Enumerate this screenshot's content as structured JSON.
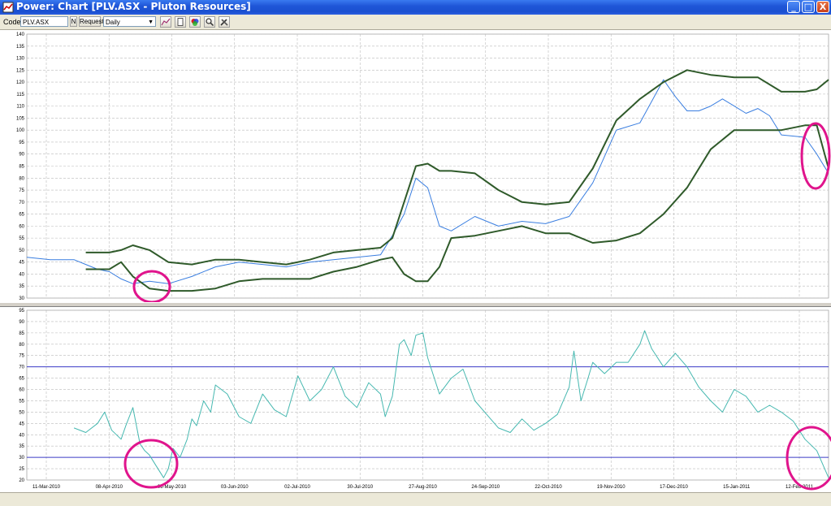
{
  "window": {
    "title": "Power: Chart [PLV.ASX - Pluton Resources]",
    "buttons": [
      "_",
      "□",
      "X"
    ]
  },
  "toolbar": {
    "code_label": "Code:",
    "code_value": "PLV.ASX",
    "n_button": "N",
    "request_button": "Request",
    "period_value": "Daily",
    "icons": [
      "indicator-icon",
      "new-chart-icon",
      "colors-icon",
      "zoom-icon",
      "tools-icon"
    ]
  },
  "colors": {
    "price": "#3a7ee0",
    "bands": "#2f5a2a",
    "band_faded": "#9fb59c",
    "rsi": "#46b8b0",
    "rsi_faded": "#b8e4e0",
    "level_lines": "#3c3cc8",
    "annotation_circle": "#e0148c",
    "grid": "#bbbbbb"
  },
  "x_axis_labels": [
    "11-Mar-2010",
    "08-Apr-2010",
    "06-May-2010",
    "03-Jun-2010",
    "02-Jul-2010",
    "30-Jul-2010",
    "27-Aug-2010",
    "24-Sep-2010",
    "22-Oct-2010",
    "19-Nov-2010",
    "17-Dec-2010",
    "15-Jan-2011",
    "12-Feb-2011"
  ],
  "chart_data": [
    {
      "type": "line",
      "y_ticks": [
        30,
        35,
        40,
        45,
        50,
        55,
        60,
        65,
        70,
        75,
        80,
        85,
        90,
        95,
        100,
        105,
        110,
        115,
        120,
        125,
        130,
        135,
        140
      ],
      "ylim": [
        30,
        140
      ],
      "grid": true,
      "series": [
        {
          "x": [
            0,
            10,
            20,
            25,
            30,
            35,
            40,
            45,
            52,
            60,
            70,
            80,
            90,
            100,
            110,
            120,
            130,
            140,
            150,
            155,
            160,
            165,
            170,
            175,
            180,
            190,
            200,
            210,
            220,
            230,
            240,
            250,
            260,
            265,
            270,
            275,
            280,
            285,
            290,
            295,
            300,
            305,
            310,
            315,
            320,
            330,
            335,
            340
          ],
          "values": [
            47,
            46,
            46,
            44,
            42,
            41,
            38,
            36,
            37,
            36,
            39,
            43,
            45,
            44,
            43,
            45,
            46,
            47,
            48,
            56,
            65,
            80,
            76,
            60,
            58,
            64,
            60,
            62,
            61,
            64,
            78,
            100,
            103,
            112,
            121,
            114,
            108,
            108,
            110,
            113,
            110,
            107,
            109,
            106,
            98,
            97,
            90,
            82
          ]
        },
        {
          "x": [
            25,
            35,
            40,
            45,
            52,
            60,
            70,
            80,
            90,
            100,
            110,
            120,
            130,
            140,
            150,
            155,
            160,
            165,
            170,
            175,
            180,
            190,
            200,
            210,
            220,
            230,
            240,
            250,
            260,
            270,
            280,
            290,
            300,
            310,
            320,
            330,
            335,
            340
          ],
          "values": [
            49,
            49,
            50,
            52,
            50,
            45,
            44,
            46,
            46,
            45,
            44,
            46,
            49,
            50,
            51,
            55,
            70,
            85,
            86,
            83,
            83,
            82,
            75,
            70,
            69,
            70,
            84,
            104,
            113,
            120,
            125,
            123,
            122,
            122,
            116,
            116,
            117,
            121
          ]
        },
        {
          "x": [
            25,
            35,
            40,
            45,
            52,
            60,
            70,
            80,
            90,
            100,
            110,
            120,
            130,
            140,
            150,
            155,
            160,
            165,
            170,
            175,
            180,
            190,
            200,
            210,
            220,
            230,
            240,
            250,
            260,
            265,
            270,
            280,
            290,
            300,
            310,
            320,
            330,
            335,
            340
          ],
          "values": [
            42,
            42,
            45,
            39,
            34,
            33,
            33,
            34,
            37,
            38,
            38,
            38,
            41,
            43,
            46,
            47,
            40,
            37,
            37,
            43,
            55,
            56,
            58,
            60,
            57,
            57,
            53,
            54,
            57,
            61,
            65,
            76,
            92,
            100,
            100,
            100,
            102,
            102,
            84
          ]
        }
      ]
    },
    {
      "type": "line",
      "y_ticks": [
        20,
        25,
        30,
        35,
        40,
        45,
        50,
        55,
        60,
        65,
        70,
        75,
        80,
        85,
        90,
        95
      ],
      "ylim": [
        20,
        95
      ],
      "grid": true,
      "series": [
        {
          "x": [
            20,
            25,
            30,
            33,
            36,
            40,
            42,
            45,
            48,
            50,
            52,
            55,
            58,
            60,
            62,
            65,
            68,
            70,
            72,
            75,
            78,
            80,
            85,
            90,
            95,
            100,
            105,
            110,
            115,
            120,
            125,
            130,
            135,
            140,
            145,
            150,
            152,
            155,
            158,
            160,
            163,
            165,
            168,
            170,
            175,
            180,
            185,
            190,
            195,
            200,
            205,
            210,
            215,
            220,
            225,
            230,
            232,
            235,
            238,
            240,
            245,
            250,
            255,
            260,
            262,
            265,
            270,
            275,
            280,
            285,
            290,
            295,
            300,
            305,
            310,
            315,
            320,
            325,
            330,
            335,
            340
          ],
          "values": [
            43,
            41,
            45,
            50,
            42,
            38,
            44,
            52,
            36,
            33,
            31,
            26,
            21,
            25,
            34,
            30,
            38,
            47,
            44,
            55,
            50,
            62,
            58,
            48,
            45,
            58,
            51,
            48,
            66,
            55,
            60,
            70,
            57,
            52,
            63,
            58,
            48,
            57,
            80,
            82,
            75,
            84,
            85,
            74,
            58,
            65,
            69,
            55,
            49,
            43,
            41,
            47,
            42,
            45,
            49,
            61,
            77,
            55,
            65,
            72,
            67,
            72,
            72,
            80,
            86,
            78,
            70,
            76,
            70,
            61,
            55,
            50,
            60,
            57,
            50,
            53,
            50,
            46,
            38,
            33,
            21
          ]
        }
      ],
      "reference_lines": [
        70,
        30
      ]
    }
  ]
}
